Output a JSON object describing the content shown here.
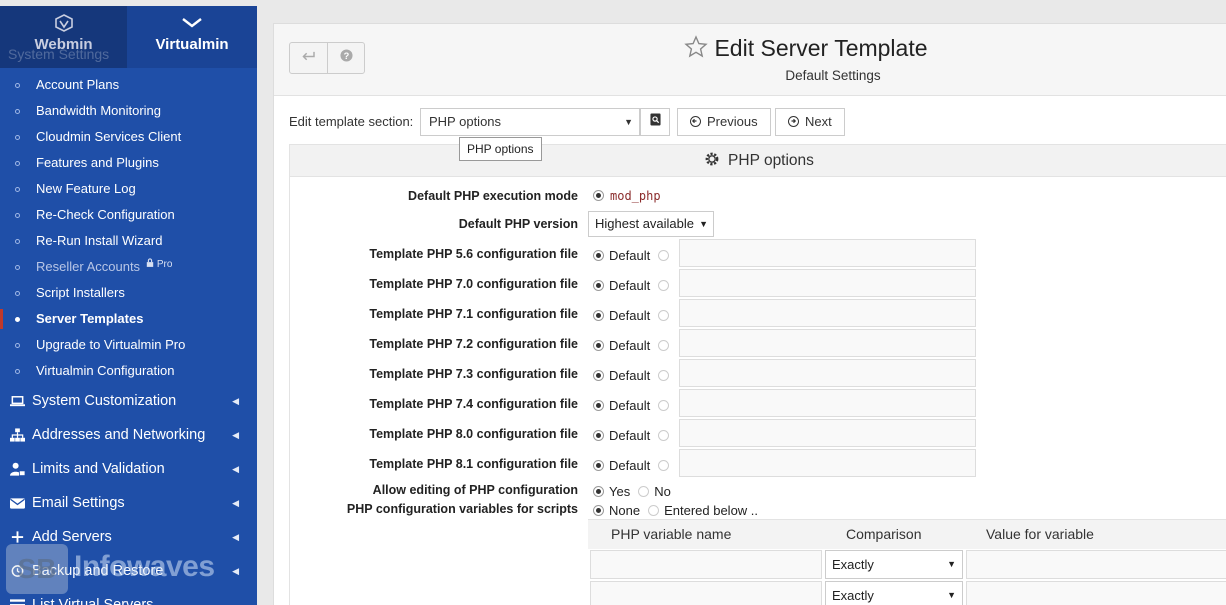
{
  "sidebar": {
    "tabs": {
      "webmin": "Webmin",
      "virtualmin": "Virtualmin"
    },
    "ghost_heading": "System Settings",
    "items": [
      {
        "label": "Account Plans",
        "state": "normal"
      },
      {
        "label": "Bandwidth Monitoring",
        "state": "normal"
      },
      {
        "label": "Cloudmin Services Client",
        "state": "normal"
      },
      {
        "label": "Features and Plugins",
        "state": "normal"
      },
      {
        "label": "New Feature Log",
        "state": "normal"
      },
      {
        "label": "Re-Check Configuration",
        "state": "normal"
      },
      {
        "label": "Re-Run Install Wizard",
        "state": "normal"
      },
      {
        "label": "Reseller Accounts",
        "state": "dim",
        "badge": "Pro"
      },
      {
        "label": "Script Installers",
        "state": "normal"
      },
      {
        "label": "Server Templates",
        "state": "active"
      },
      {
        "label": "Upgrade to Virtualmin Pro",
        "state": "normal"
      },
      {
        "label": "Virtualmin Configuration",
        "state": "normal"
      }
    ],
    "categories": [
      {
        "label": "System Customization",
        "icon": "laptop-icon"
      },
      {
        "label": "Addresses and Networking",
        "icon": "sitemap-icon"
      },
      {
        "label": "Limits and Validation",
        "icon": "user-lock-icon"
      },
      {
        "label": "Email Settings",
        "icon": "envelope-icon"
      },
      {
        "label": "Add Servers",
        "icon": "plus-icon"
      },
      {
        "label": "Backup and Restore",
        "icon": "history-icon"
      },
      {
        "label": "List Virtual Servers",
        "icon": "list-icon"
      }
    ]
  },
  "watermark": {
    "logo": "SB",
    "text": "Infowaves"
  },
  "header": {
    "title": "Edit Server Template",
    "subtitle": "Default Settings",
    "back_icon": "return-arrow-icon",
    "help_icon": "question-icon"
  },
  "section_bar": {
    "label": "Edit template section:",
    "selected": "PHP options",
    "tooltip": "PHP options",
    "previous": "Previous",
    "next": "Next"
  },
  "panel": {
    "title": "PHP options",
    "exec_mode": {
      "label": "Default PHP execution mode",
      "value": "mod_php"
    },
    "version": {
      "label": "Default PHP version",
      "value": "Highest available"
    },
    "config_files": [
      {
        "label": "Template PHP 5.6 configuration file",
        "option": "Default"
      },
      {
        "label": "Template PHP 7.0 configuration file",
        "option": "Default"
      },
      {
        "label": "Template PHP 7.1 configuration file",
        "option": "Default"
      },
      {
        "label": "Template PHP 7.2 configuration file",
        "option": "Default"
      },
      {
        "label": "Template PHP 7.3 configuration file",
        "option": "Default"
      },
      {
        "label": "Template PHP 7.4 configuration file",
        "option": "Default"
      },
      {
        "label": "Template PHP 8.0 configuration file",
        "option": "Default"
      },
      {
        "label": "Template PHP 8.1 configuration file",
        "option": "Default"
      }
    ],
    "allow_edit": {
      "label": "Allow editing of PHP configuration",
      "yes": "Yes",
      "no": "No"
    },
    "vars": {
      "label": "PHP configuration variables for scripts",
      "none": "None",
      "entered": "Entered below ..",
      "headers": {
        "name": "PHP variable name",
        "comparison": "Comparison",
        "value": "Value for variable"
      },
      "rows": [
        {
          "comparison": "Exactly"
        },
        {
          "comparison": "Exactly"
        }
      ]
    }
  }
}
